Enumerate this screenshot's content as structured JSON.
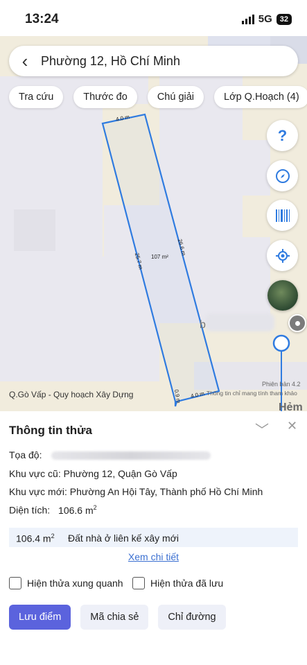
{
  "status": {
    "time": "13:24",
    "network": "5G",
    "battery": "32"
  },
  "search": {
    "back_icon": "chevron-left-icon",
    "value": "Phường 12, Hồ Chí Minh"
  },
  "chips": [
    "Tra cứu",
    "Thước đo",
    "Chú giải",
    "Lớp Q.Hoạch (4)"
  ],
  "map": {
    "parcel": {
      "top_edge": "4.0 m",
      "left_edge": "25.7 m",
      "right_edge": "26.6 m",
      "bottom_edge": "4.0 m",
      "corner_edge": "0.9 m",
      "area": "107 m²"
    },
    "label": "Q.Gò Vấp - Quy hoạch Xây Dựng",
    "version": "Phiên bản 4.2",
    "disclaimer": "Thông tin chỉ mang tính tham khảo",
    "street": "Hẻm",
    "marker_letter": "b",
    "controls": [
      "question-icon",
      "compass-icon",
      "barcode-icon",
      "locate-icon",
      "satellite-layer-icon"
    ],
    "parcel_color": "#2f7be0"
  },
  "panel": {
    "title": "Thông tin thửa",
    "coord_label": "Tọa độ:",
    "old_area": "Khu vực cũ: Phường 12, Quận Gò Vấp",
    "new_area": "Khu vực mới: Phường An Hội Tây, Thành phố Hồ Chí Minh",
    "area_label": "Diện tích:",
    "area_value": "106.6 m",
    "area_sup": "2",
    "land_value": "106.4 m",
    "land_sup": "2",
    "land_desc": "Đất nhà ở liên kế xây mới",
    "detail_link": "Xem chi tiết",
    "check_nearby": "Hiện thửa xung quanh",
    "check_saved": "Hiện thửa đã lưu",
    "btn_save": "Lưu điểm",
    "btn_share": "Mã chia sẻ",
    "btn_direction": "Chỉ đường"
  },
  "colors": {
    "primary": "#5b63dd",
    "link": "#3a6fd1"
  }
}
